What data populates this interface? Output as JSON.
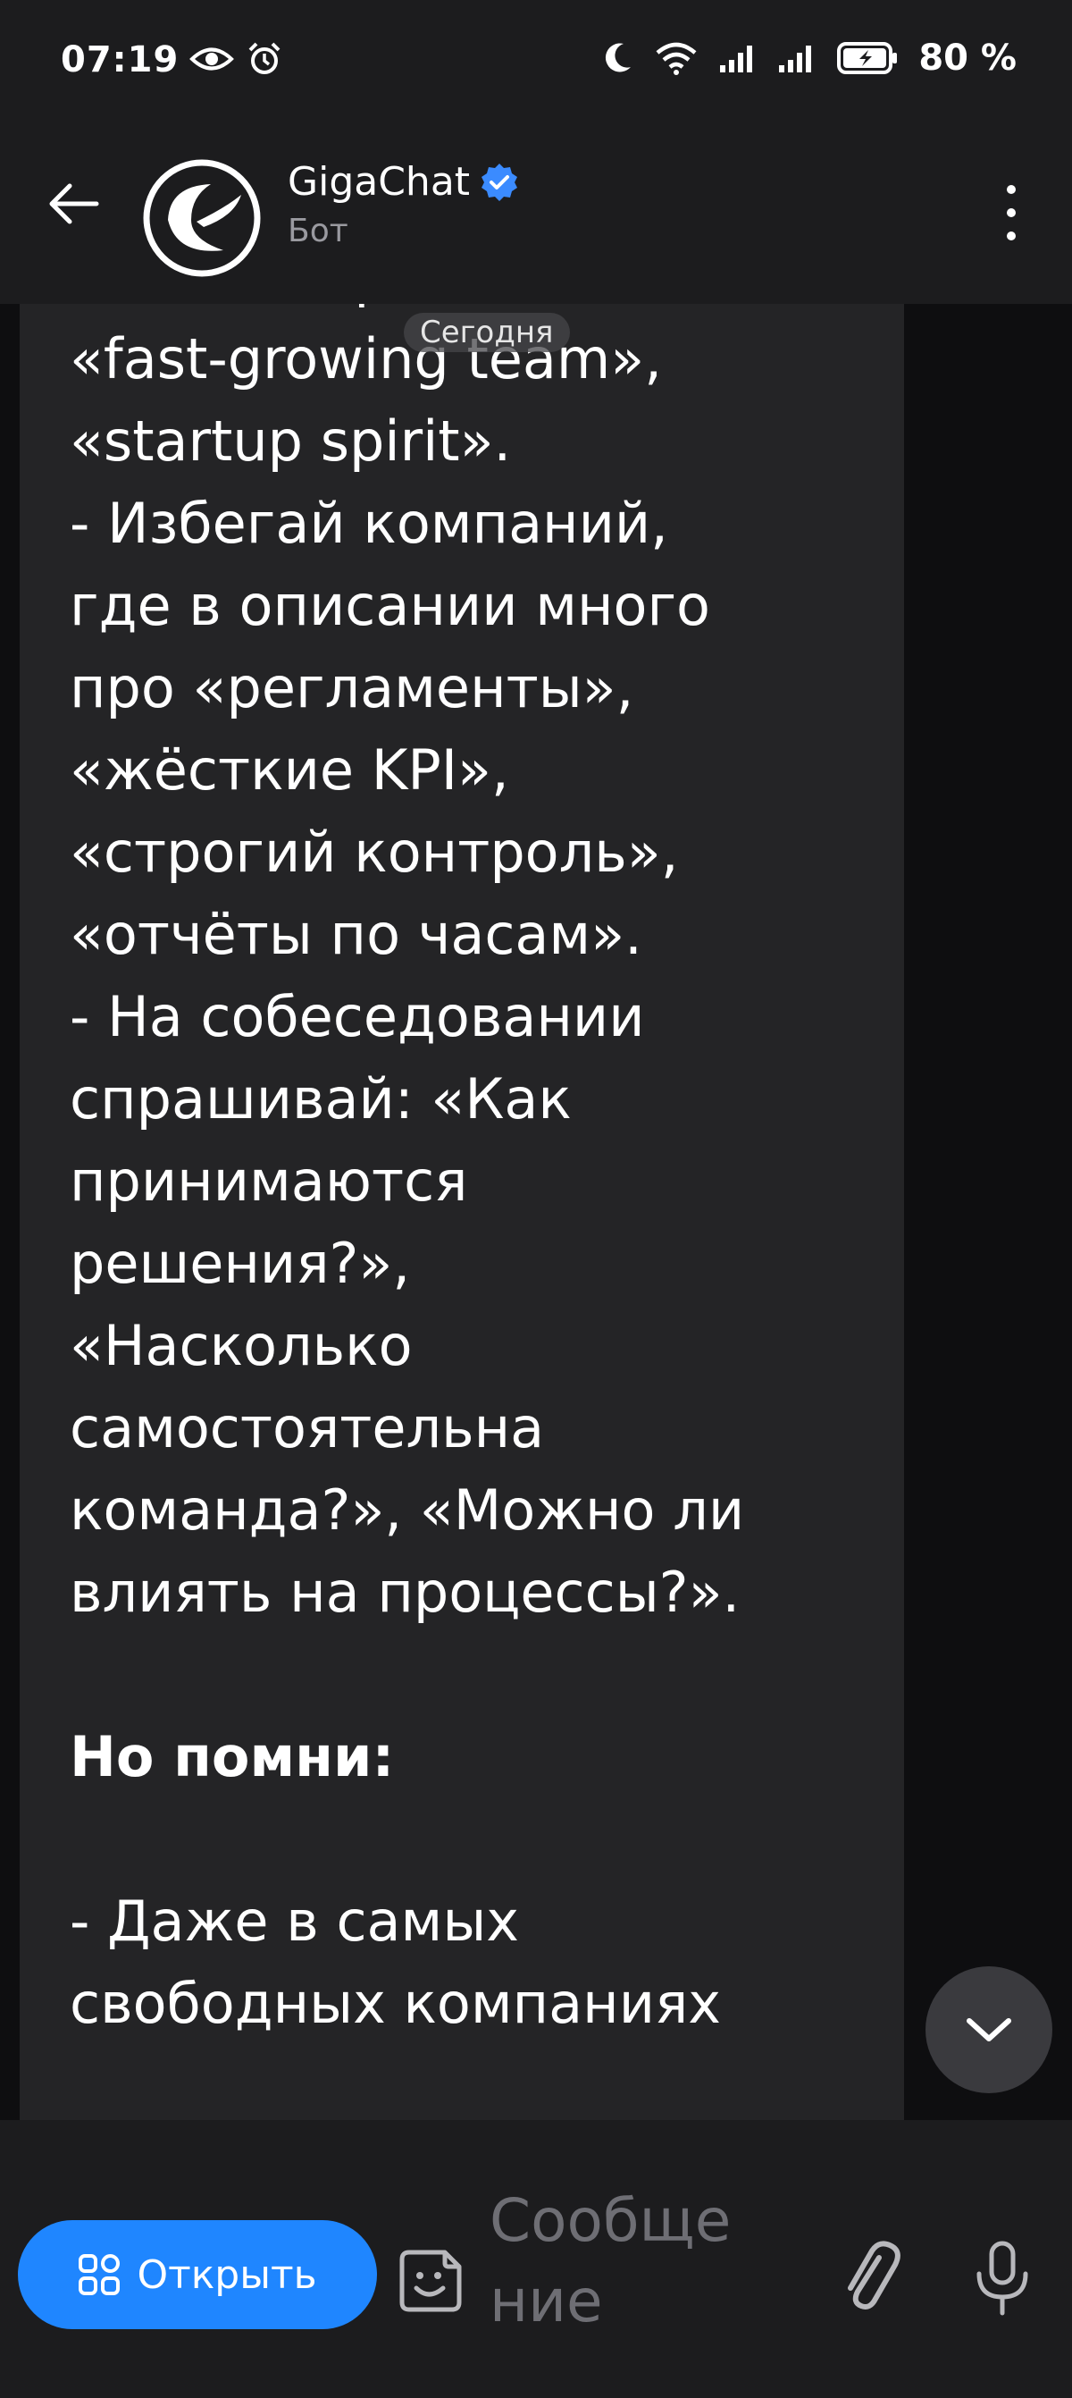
{
  "status_bar": {
    "time": "07:19",
    "battery": "80 %"
  },
  "header": {
    "title": "GigaChat",
    "subtitle": "Бот"
  },
  "chat": {
    "date_chip": "Сегодня",
    "message_lines": [
      {
        "text": "«ownership»,",
        "style": "normal"
      },
      {
        "text": "«fast-growing team»,",
        "style": "normal"
      },
      {
        "text": "«startup spirit».",
        "style": "normal"
      },
      {
        "text": "- Избегай компаний,",
        "style": "normal"
      },
      {
        "text": "где в описании много",
        "style": "normal"
      },
      {
        "text": "про «регламенты»,",
        "style": "normal"
      },
      {
        "text": "«жёсткие KPI»,",
        "style": "normal"
      },
      {
        "text": "«строгий контроль»,",
        "style": "normal"
      },
      {
        "text": "«отчёты по часам».",
        "style": "normal"
      },
      {
        "text": "- На собеседовании",
        "style": "normal"
      },
      {
        "text": "спрашивай: «Как",
        "style": "normal"
      },
      {
        "text": "принимаются",
        "style": "normal"
      },
      {
        "text": "решения?»,",
        "style": "normal"
      },
      {
        "text": "«Насколько",
        "style": "normal"
      },
      {
        "text": "самостоятельна",
        "style": "normal"
      },
      {
        "text": "команда?», «Можно ли",
        "style": "normal"
      },
      {
        "text": "влиять на процессы?».",
        "style": "normal"
      },
      {
        "text": "",
        "style": "blank"
      },
      {
        "text": "Но помни:",
        "style": "bold"
      },
      {
        "text": "",
        "style": "blank"
      },
      {
        "text": "- Даже в самых",
        "style": "normal"
      },
      {
        "text": "свободных компаниях",
        "style": "normal"
      }
    ]
  },
  "input_bar": {
    "open_label": "Открыть",
    "placeholder_line1": "Сообще",
    "placeholder_line2": "ние"
  },
  "colors": {
    "accent": "#1f86ff",
    "verified": "#3b8bff",
    "bubble": "#242426",
    "header_bg": "#1c1c1e"
  },
  "icons": {
    "status_left": [
      "eye-icon",
      "alarm-icon"
    ],
    "status_right": [
      "moon-icon",
      "wifi-icon",
      "signal-icon",
      "signal-icon",
      "battery-charging-icon"
    ],
    "header": [
      "back-arrow-icon",
      "gigachat-logo-icon",
      "verified-icon",
      "more-vertical-icon"
    ],
    "input": [
      "grid-icon",
      "sticker-icon",
      "paperclip-icon",
      "microphone-icon"
    ],
    "chat": [
      "chevron-down-icon"
    ]
  }
}
